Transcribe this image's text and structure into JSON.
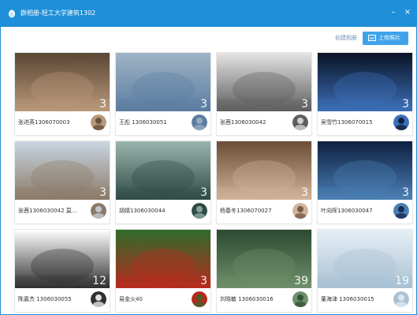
{
  "window": {
    "title": "群相册-轻工大学建筑1302",
    "minimize_glyph": "–",
    "close_glyph": "×"
  },
  "toolbar": {
    "create_album_label": "创建相册",
    "upload_label": "上传照片",
    "upload_icon": "upload-photo-icon"
  },
  "albums": [
    {
      "caption": "张进英1306070003",
      "count": "3",
      "avatar_icon": "avatar-landscape-icon",
      "colors": [
        "#5a4634",
        "#b9987a"
      ]
    },
    {
      "caption": "王彪 1306030051",
      "count": "3",
      "avatar_icon": "avatar-swirl-icon",
      "colors": [
        "#9fb4c6",
        "#5c7da0"
      ]
    },
    {
      "caption": "张茜1306030042",
      "count": "3",
      "avatar_icon": "avatar-doll-icon",
      "colors": [
        "#e4e4e4",
        "#5e5e5e"
      ]
    },
    {
      "caption": "吴雪竹1306070015",
      "count": "3",
      "avatar_icon": "avatar-feather-icon",
      "colors": [
        "#0a1326",
        "#3c6fb8"
      ]
    },
    {
      "caption": "张茜1306030042 莫...",
      "count": "3",
      "avatar_icon": "avatar-doll-icon",
      "colors": [
        "#c9d6e2",
        "#8b7a68"
      ]
    },
    {
      "caption": "胡婧1306030044",
      "count": "3",
      "avatar_icon": "avatar-girl-icon",
      "colors": [
        "#9ab5ad",
        "#2e4b45"
      ]
    },
    {
      "caption": "杨春冬1306070027",
      "count": "3",
      "avatar_icon": "avatar-dark-icon",
      "colors": [
        "#6b4c36",
        "#d1b39a"
      ]
    },
    {
      "caption": "叶向晖1306030047",
      "count": "3",
      "avatar_icon": "avatar-flower-icon",
      "colors": [
        "#0e2040",
        "#4a7fb5"
      ]
    },
    {
      "caption": "陈嘉杰 1306030055",
      "count": "12",
      "avatar_icon": "avatar-anime-icon",
      "colors": [
        "#ffffff",
        "#303030"
      ]
    },
    {
      "caption": "易金火40",
      "count": "3",
      "avatar_icon": "avatar-logo-icon",
      "colors": [
        "#2f6b2a",
        "#b62a1e"
      ]
    },
    {
      "caption": "刘晓敏 1306030016",
      "count": "39",
      "avatar_icon": "avatar-grey-icon",
      "colors": [
        "#2b4a30",
        "#6f8f6a"
      ]
    },
    {
      "caption": "董海津 1306030015",
      "count": "19",
      "avatar_icon": "avatar-cartoon-icon",
      "colors": [
        "#e6eff6",
        "#a9c1d3"
      ]
    }
  ]
}
